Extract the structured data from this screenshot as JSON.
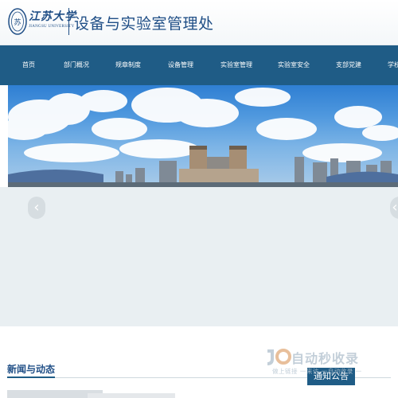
{
  "header": {
    "logo_cn": "江苏大学",
    "logo_en": "JIANGSU UNIVERSITY",
    "title": "设备与实验室管理处"
  },
  "nav": {
    "items": [
      {
        "label": "首页"
      },
      {
        "label": "部门概况"
      },
      {
        "label": "规章制度"
      },
      {
        "label": "设备管理"
      },
      {
        "label": "实验室管理"
      },
      {
        "label": "实验室安全"
      },
      {
        "label": "支部党建"
      },
      {
        "label": "学校"
      }
    ]
  },
  "slider": {
    "prev_icon": "chevron-left-icon",
    "next_icon": "chevron-right-icon",
    "prev_glyph": "‹",
    "next_glyph": "‹"
  },
  "news": {
    "title": "新闻与动态",
    "notice_tab": "通知公告"
  },
  "watermark": {
    "main": "自动秒收录",
    "sub": "做上链接 一来访 一自动收录 一"
  },
  "colors": {
    "brand_blue": "#1f5c86",
    "title_blue": "#1f4e86",
    "slider_bg": "#e9eff2"
  }
}
